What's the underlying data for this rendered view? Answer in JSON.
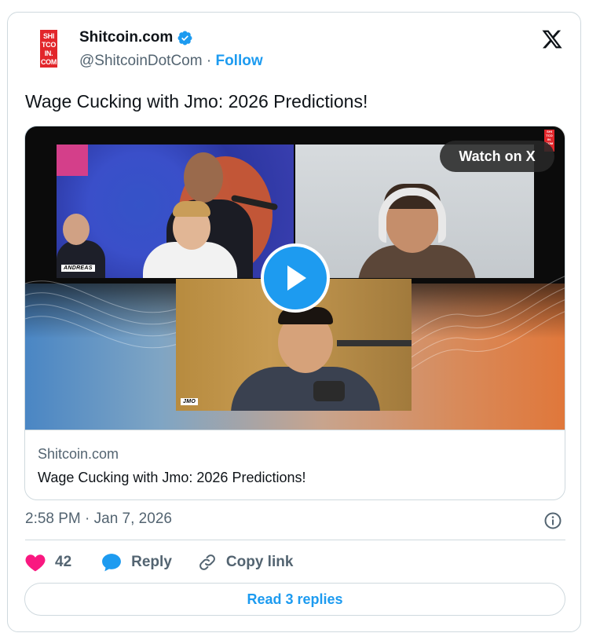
{
  "author": {
    "display_name": "Shitcoin.com",
    "handle": "@ShitcoinDotCom",
    "separator": "·",
    "follow_label": "Follow",
    "verified": true,
    "avatar_lines": [
      "SHI",
      "TCO",
      "IN.",
      "COM"
    ]
  },
  "post": {
    "text": "Wage Cucking with Jmo: 2026 Predictions!"
  },
  "media": {
    "watch_label": "Watch on X",
    "speaker_tags": [
      "ANDREAS",
      "JMO"
    ],
    "corner_badge_lines": [
      "SHI",
      "TCO",
      "IN.",
      "COM"
    ]
  },
  "link_card": {
    "domain": "Shitcoin.com",
    "title": "Wage Cucking with Jmo: 2026 Predictions!"
  },
  "meta": {
    "timestamp": "2:58 PM · Jan 7, 2026"
  },
  "actions": {
    "like_count": "42",
    "reply_label": "Reply",
    "copy_label": "Copy link",
    "read_replies_label": "Read 3 replies"
  },
  "colors": {
    "accent": "#1d9bf0",
    "like": "#f91880",
    "brand_red": "#e2262b",
    "muted_text": "#536471",
    "border": "#cfd9de"
  },
  "icons": {
    "platform": "x-logo-icon",
    "verified": "verified-badge-icon",
    "play": "play-icon",
    "info": "info-icon",
    "like": "heart-icon",
    "reply": "reply-bubble-icon",
    "copy": "link-icon"
  }
}
